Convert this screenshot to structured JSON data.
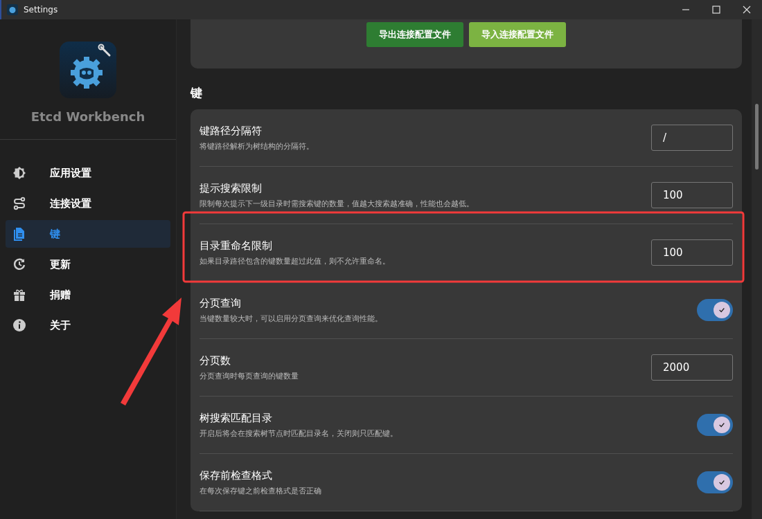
{
  "window": {
    "title": "Settings"
  },
  "sidebar": {
    "app_name": "Etcd Workbench",
    "items": [
      {
        "label": "应用设置",
        "selected": false
      },
      {
        "label": "连接设置",
        "selected": false
      },
      {
        "label": "键",
        "selected": true
      },
      {
        "label": "更新",
        "selected": false
      },
      {
        "label": "捐赠",
        "selected": false
      },
      {
        "label": "关于",
        "selected": false
      }
    ]
  },
  "top_card": {
    "buttons": [
      {
        "label": "导出连接配置文件",
        "kind": "primary"
      },
      {
        "label": "导入连接配置文件",
        "kind": "secondary"
      }
    ]
  },
  "section": {
    "title": "键",
    "rows": [
      {
        "kind": "input",
        "title": "键路径分隔符",
        "description": "将键路径解析为树结构的分隔符。",
        "value": "/"
      },
      {
        "kind": "input",
        "title": "提示搜索限制",
        "description": "限制每次提示下一级目录时需搜索键的数量，值越大搜索越准确，性能也会越低。",
        "value": "100"
      },
      {
        "kind": "input",
        "title": "目录重命名限制",
        "description": "如果目录路径包含的键数量超过此值，则不允许重命名。",
        "value": "100"
      },
      {
        "kind": "toggle",
        "title": "分页查询",
        "description": "当键数量较大时，可以启用分页查询来优化查询性能。",
        "on": true
      },
      {
        "kind": "input",
        "title": "分页数",
        "description": "分页查询时每页查询的键数量",
        "value": "2000"
      },
      {
        "kind": "toggle",
        "title": "树搜索匹配目录",
        "description": "开启后将会在搜索树节点时匹配目录名，关闭则只匹配键。",
        "on": true
      },
      {
        "kind": "toggle",
        "title": "保存前检查格式",
        "description": "在每次保存键之前检查格式是否正确",
        "on": true
      }
    ]
  }
}
